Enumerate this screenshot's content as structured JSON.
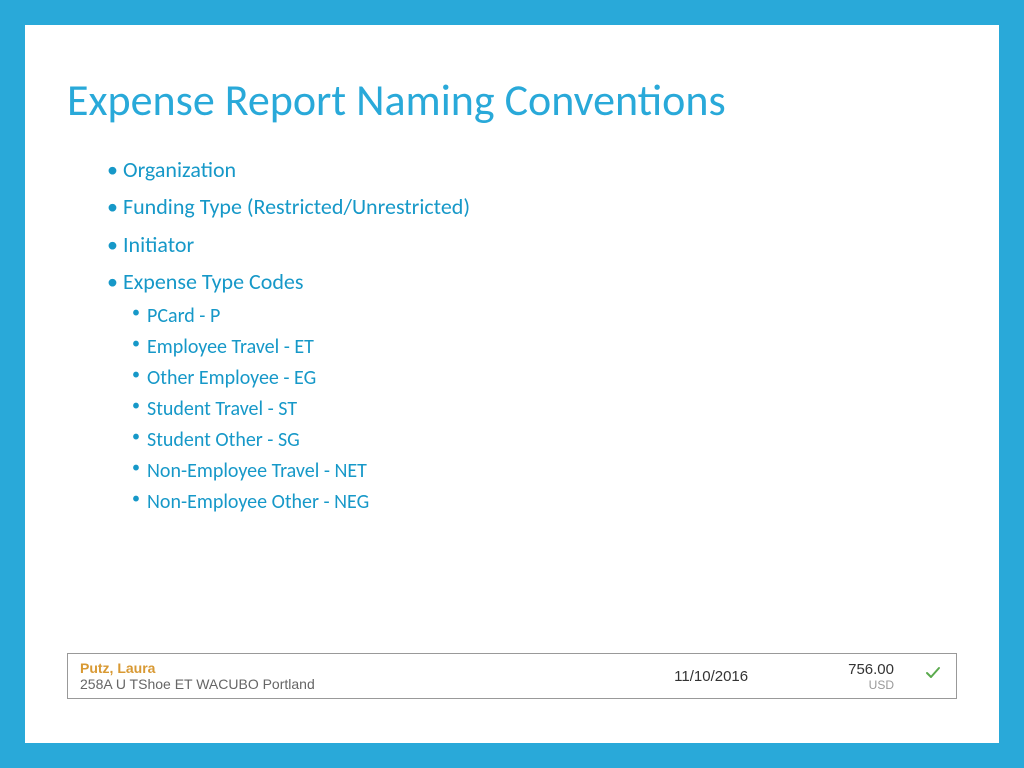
{
  "title": "Expense Report  Naming Conventions",
  "bullets": {
    "item0": "Organization",
    "item1": "Funding Type (Restricted/Unrestricted)",
    "item2": "Initiator",
    "item3": "Expense Type Codes",
    "sub": {
      "s0": "PCard - P",
      "s1": "Employee Travel - ET",
      "s2": "Other Employee  - EG",
      "s3": "Student Travel - ST",
      "s4": "Student Other - SG",
      "s5": "Non-Employee Travel - NET",
      "s6": "Non-Employee Other - NEG"
    }
  },
  "example": {
    "name": "Putz, Laura",
    "description": "258A U TShoe ET WACUBO Portland",
    "date": "11/10/2016",
    "amount": "756.00",
    "currency": "USD"
  }
}
